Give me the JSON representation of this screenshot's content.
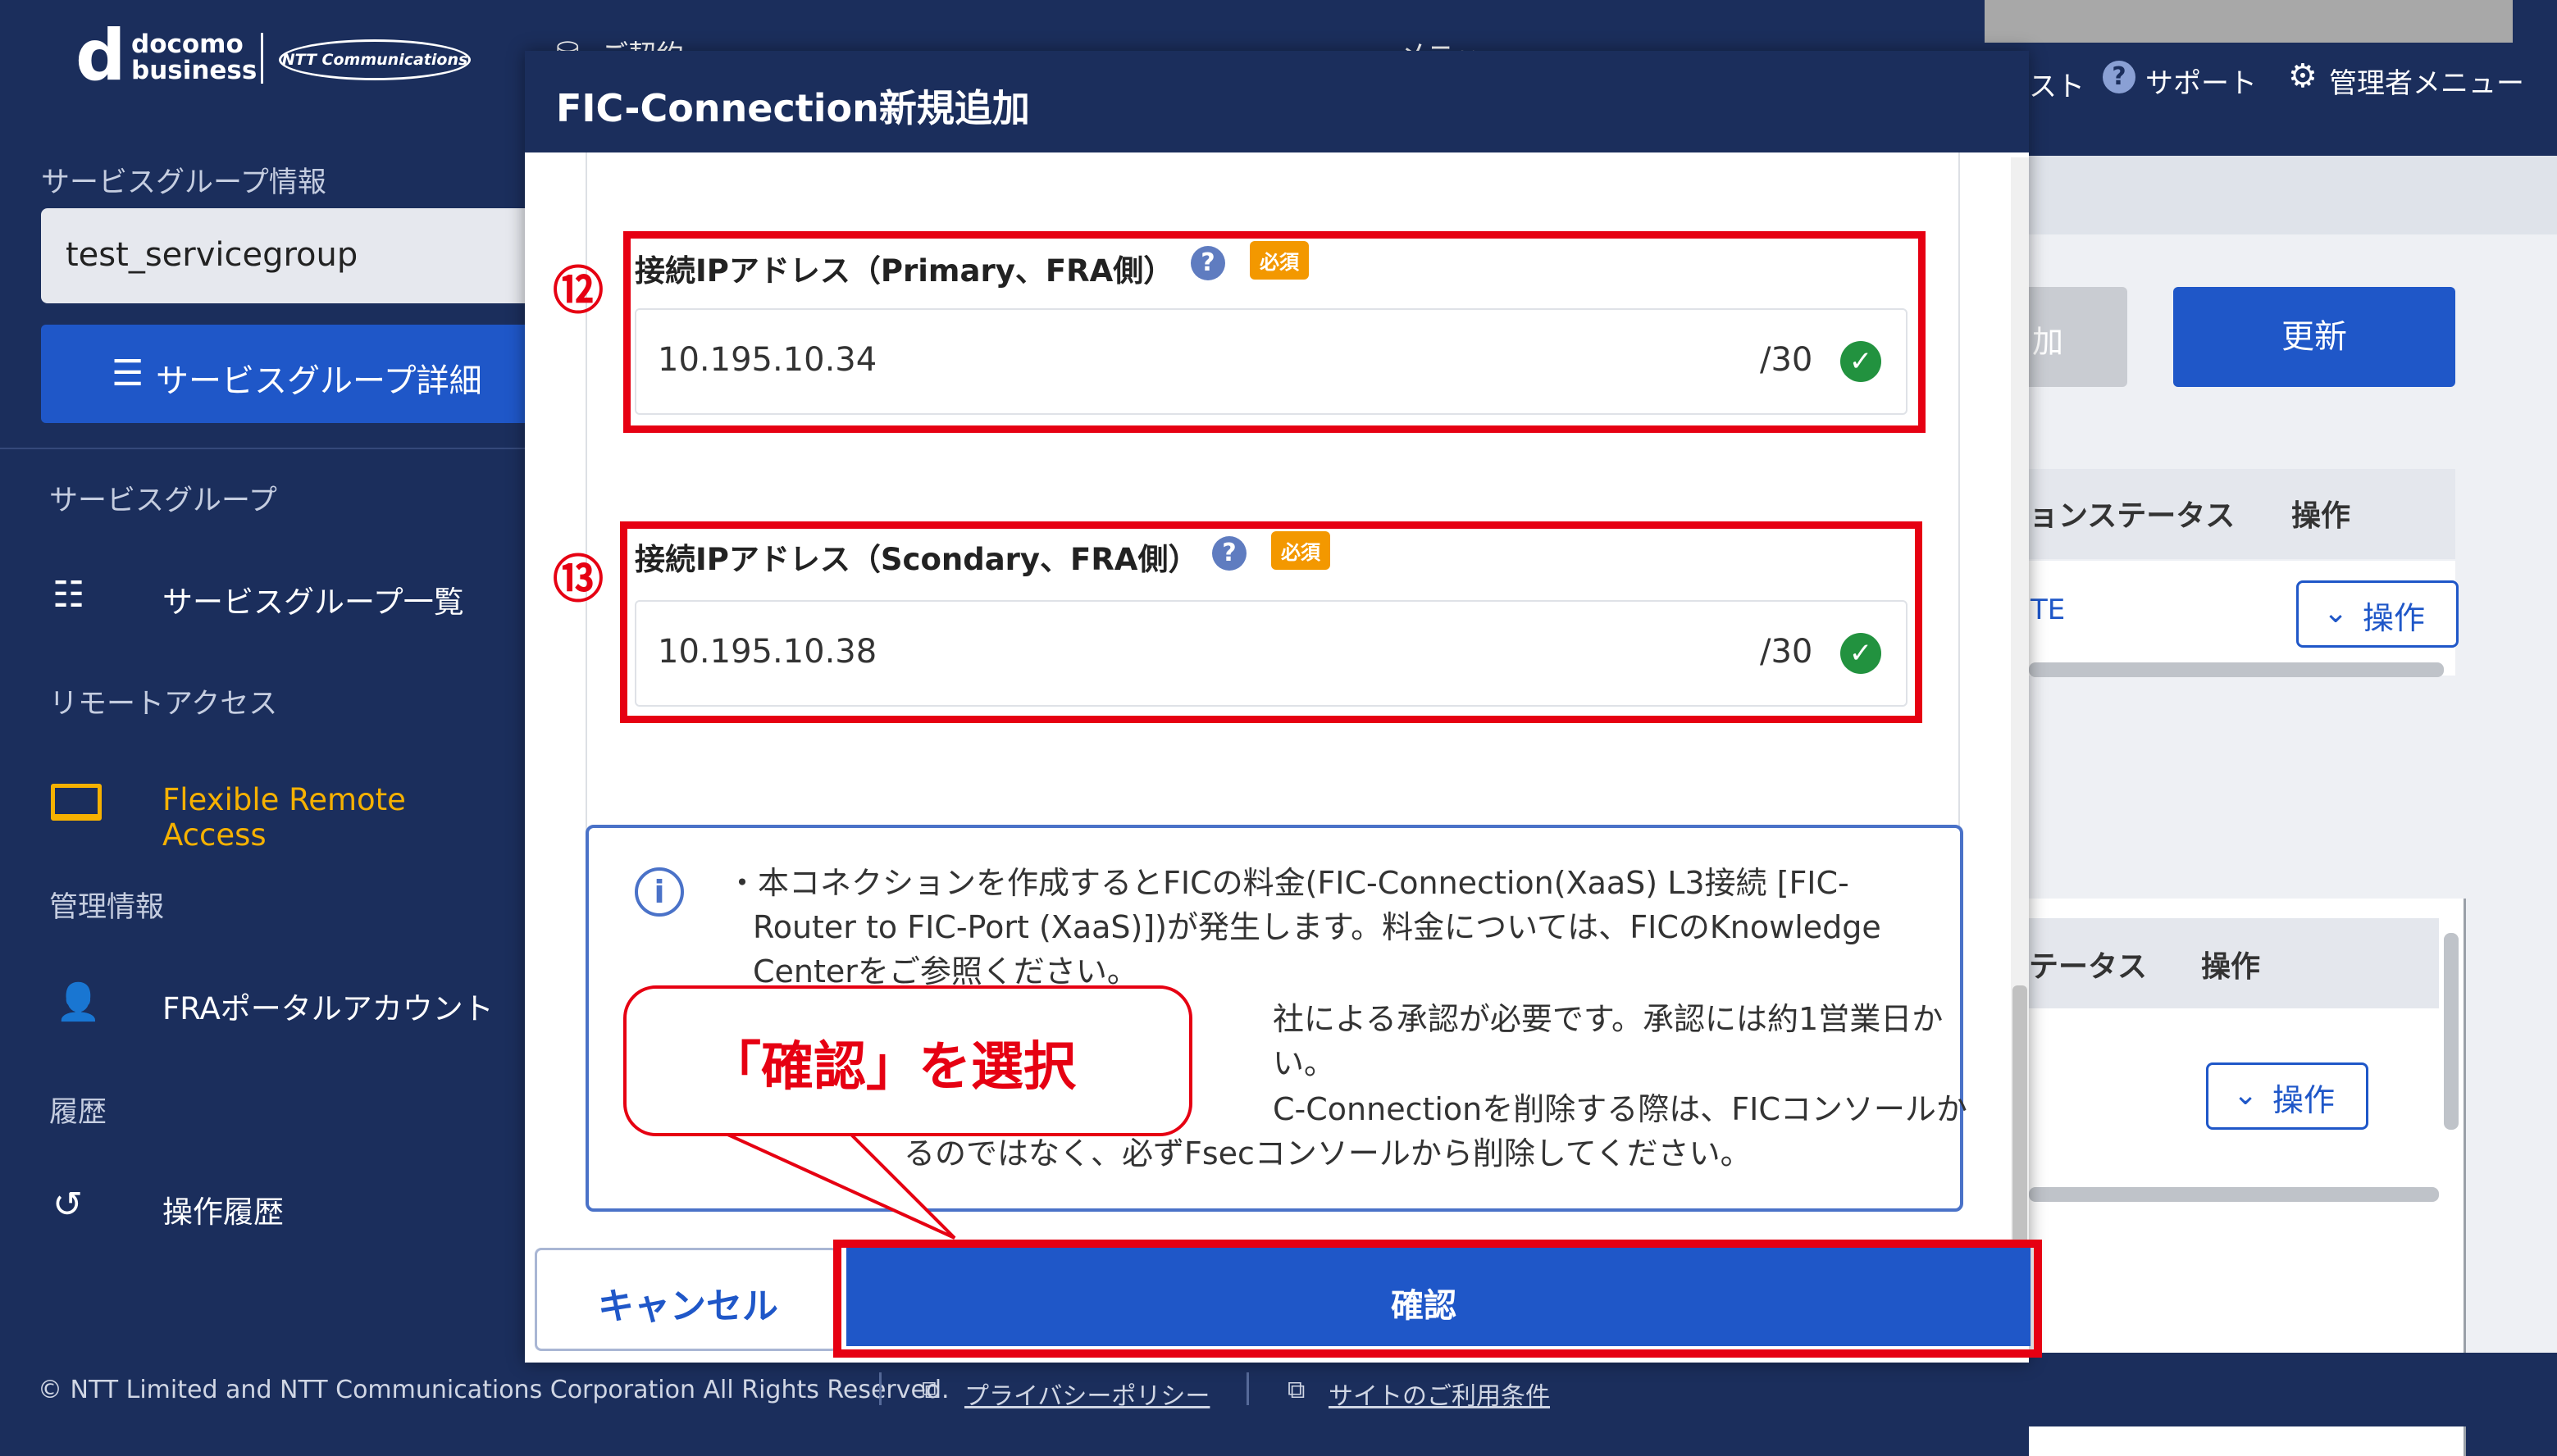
{
  "brand": {
    "docomo_line1": "docomo",
    "docomo_line2": "business",
    "ntt_logo": "NTT Communications"
  },
  "sidebar": {
    "service_group_info_label": "サービスグループ情報",
    "service_group_value": "test_servicegroup",
    "service_group_detail_button": "サービスグループ詳細",
    "section_service_group": "サービスグループ",
    "item_service_group_list": "サービスグループ一覧",
    "section_remote_access": "リモートアクセス",
    "item_flexible_remote_access": "Flexible Remote Access",
    "section_admin_info": "管理情報",
    "item_fra_portal_account": "FRAポータルアカウント",
    "section_history": "履歴",
    "item_operation_history": "操作履歴"
  },
  "topbar": {
    "crumb_partial_1": "ご契約",
    "crumb_partial_2": "メニュー",
    "right_partial": "スト",
    "support": "サポート",
    "admin_menu": "管理者メニュー"
  },
  "main": {
    "add_partial": "加",
    "update_button": "更新",
    "table1_col_status": "ョンステータス",
    "table1_col_op": "操作",
    "table1_row_status": "TE",
    "table1_op_button": "操作",
    "table2_col_status": "テータス",
    "table2_col_op": "操作",
    "table2_op_button": "操作"
  },
  "modal": {
    "title": "FIC-Connection新規追加",
    "field12": {
      "marker": "⑫",
      "label": "接続IPアドレス（Primary、FRA側）",
      "required": "必須",
      "value": "10.195.10.34",
      "suffix": "/30"
    },
    "field13": {
      "marker": "⑬",
      "label": "接続IPアドレス（Scondary、FRA側）",
      "required": "必須",
      "value": "10.195.10.38",
      "suffix": "/30"
    },
    "info": {
      "line1": "・本コネクションを作成するとFICの料金(FIC-Connection(XaaS) L3接続 [FIC-",
      "line2": "Router to FIC-Port (XaaS)])が発生します。料金については、FICのKnowledge",
      "line3": "Centerをご参照ください。",
      "line4": "社による承認が必要です。承認には約1営業日か",
      "line5": "い。",
      "line6": "C-Connectionを削除する際は、FICコンソールか",
      "line7": "るのではなく、必ずFsecコンソールから削除してください。"
    },
    "callout": "「確認」を選択",
    "cancel_button": "キャンセル",
    "confirm_button": "確認"
  },
  "footer": {
    "copyright": "© NTT Limited and NTT Communications Corporation All Rights Reserved.",
    "privacy": "プライバシーポリシー",
    "terms": "サイトのご利用条件"
  },
  "colors": {
    "navy": "#1b2e5c",
    "primary": "#1f57c8",
    "annotation_red": "#e60012",
    "required_orange": "#f39800",
    "active_nav": "#f6b100"
  }
}
